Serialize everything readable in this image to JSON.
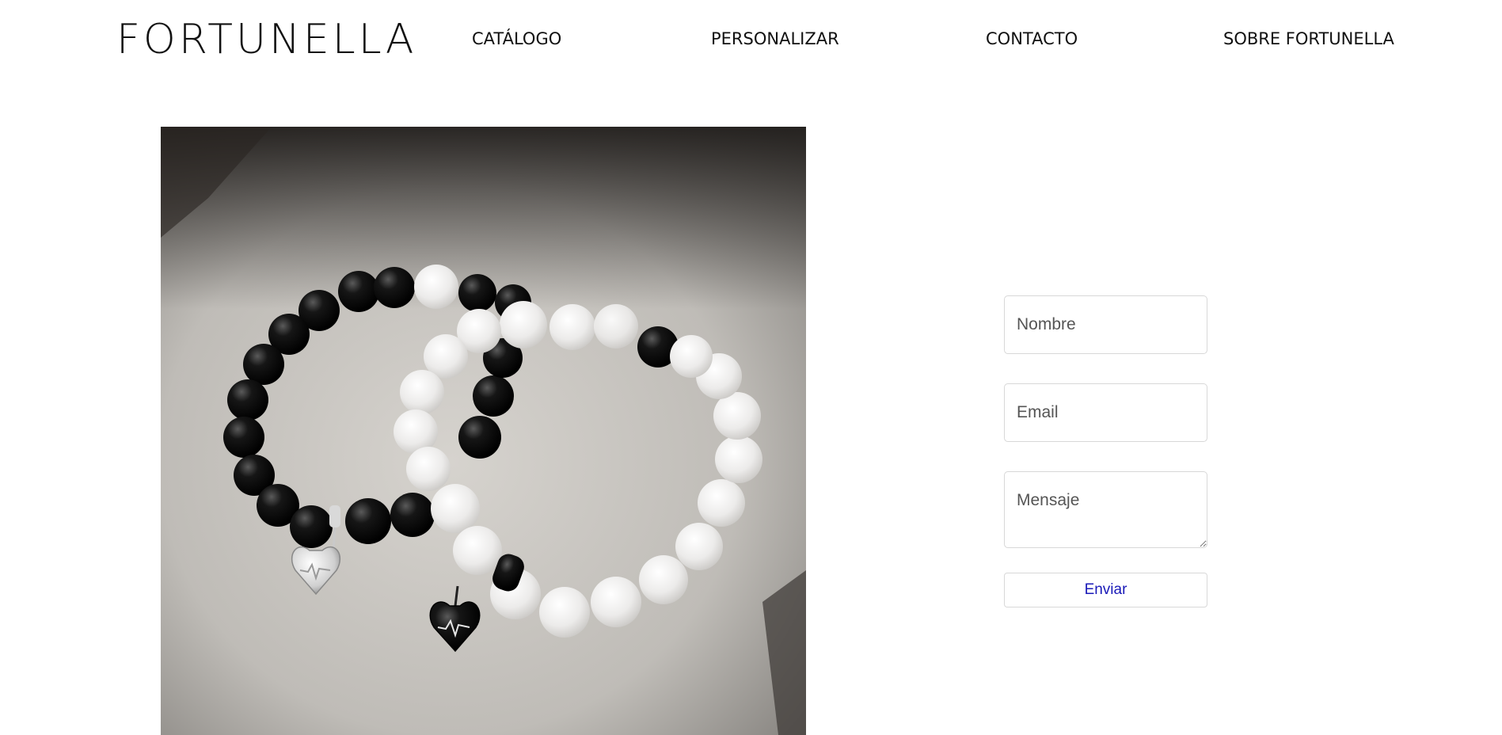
{
  "header": {
    "logo_text": "FORTUNELLA",
    "nav": [
      {
        "label": "CATÁLOGO"
      },
      {
        "label": "PERSONALIZAR"
      },
      {
        "label": "CONTACTO"
      },
      {
        "label": "SOBRE FORTUNELLA"
      }
    ]
  },
  "hero_image": {
    "subject": "Black onyx and white jade bead bracelets with heart charms on grey stone"
  },
  "contact_form": {
    "name_placeholder": "Nombre",
    "email_placeholder": "Email",
    "message_placeholder": "Mensaje",
    "name_value": "",
    "email_value": "",
    "message_value": "",
    "submit_label": "Enviar"
  },
  "colors": {
    "text": "#111111",
    "button_text": "#1a1ab8",
    "field_border": "#d8d8d8",
    "background": "#ffffff"
  }
}
